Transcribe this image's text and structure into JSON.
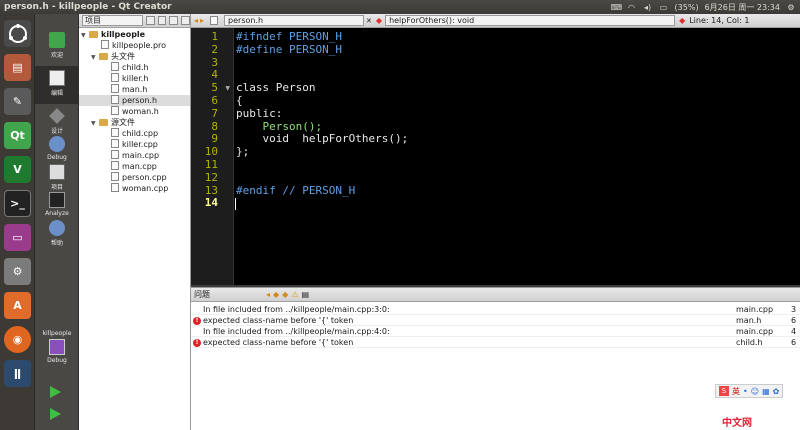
{
  "window": {
    "title": "person.h - killpeople - Qt Creator"
  },
  "indicators": {
    "battery": "(35%)",
    "datetime": "6月26日 周一 23:34"
  },
  "modes": [
    {
      "label": "欢迎"
    },
    {
      "label": "编辑"
    },
    {
      "label": "设计"
    },
    {
      "label": "Debug"
    },
    {
      "label": "项目"
    },
    {
      "label": "Analyze"
    },
    {
      "label": "帮助"
    }
  ],
  "kit": {
    "project": "killpeople",
    "mode": "Debug"
  },
  "project_pane": {
    "selector": "项目",
    "tree": [
      {
        "label": "killpeople",
        "kind": "project"
      },
      {
        "label": "killpeople.pro",
        "kind": "file"
      },
      {
        "label": "头文件",
        "kind": "folder"
      },
      {
        "label": "child.h",
        "kind": "file"
      },
      {
        "label": "killer.h",
        "kind": "file"
      },
      {
        "label": "man.h",
        "kind": "file"
      },
      {
        "label": "person.h",
        "kind": "file",
        "selected": true
      },
      {
        "label": "woman.h",
        "kind": "file"
      },
      {
        "label": "源文件",
        "kind": "folder"
      },
      {
        "label": "child.cpp",
        "kind": "file"
      },
      {
        "label": "killer.cpp",
        "kind": "file"
      },
      {
        "label": "main.cpp",
        "kind": "file"
      },
      {
        "label": "man.cpp",
        "kind": "file"
      },
      {
        "label": "person.cpp",
        "kind": "file"
      },
      {
        "label": "woman.cpp",
        "kind": "file"
      }
    ]
  },
  "editor": {
    "file": "person.h",
    "symbol": "helpForOthers(): void",
    "position": "Line: 14, Col: 1",
    "line_numbers": [
      "1",
      "2",
      "3",
      "4",
      "5",
      "6",
      "7",
      "8",
      "9",
      "10",
      "11",
      "12",
      "13",
      "14"
    ],
    "lines": [
      {
        "t": "#ifndef PERSON_H"
      },
      {
        "t": "#define PERSON_H"
      },
      {
        "t": ""
      },
      {
        "t": ""
      },
      {
        "t": "class Person"
      },
      {
        "t": "{"
      },
      {
        "t": "public:"
      },
      {
        "t": "    Person();"
      },
      {
        "t": "    void  helpForOthers();"
      },
      {
        "t": "};"
      },
      {
        "t": ""
      },
      {
        "t": ""
      },
      {
        "t": "#endif // PERSON_H"
      },
      {
        "t": ""
      }
    ]
  },
  "issues": {
    "title": "问题",
    "rows": [
      {
        "type": "info",
        "message": "In file included from ../killpeople/main.cpp:3:0:",
        "file": "main.cpp",
        "line": "3"
      },
      {
        "type": "error",
        "message": "expected class-name before '{' token",
        "file": "man.h",
        "line": "6"
      },
      {
        "type": "info",
        "message": "In file included from ../killpeople/main.cpp:4:0:",
        "file": "main.cpp",
        "line": "4"
      },
      {
        "type": "error",
        "message": "expected class-name before '{' token",
        "file": "child.h",
        "line": "6"
      }
    ]
  },
  "ime": {
    "label": "英"
  },
  "watermark": "中文网"
}
